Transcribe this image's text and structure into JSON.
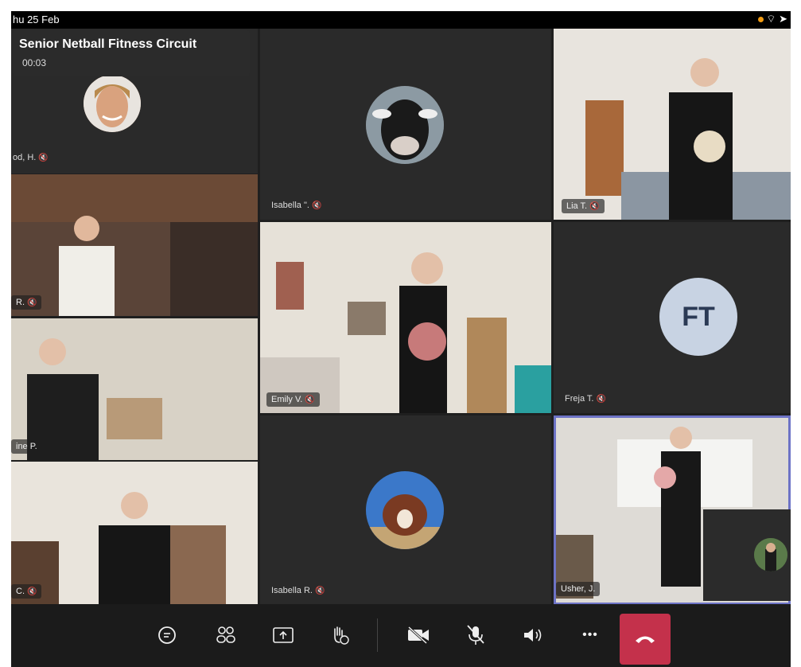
{
  "status_bar": {
    "time": "hu 25 Feb",
    "icons": "◉ ✈"
  },
  "meeting": {
    "title": "Senior Netball Fitness Circuit",
    "timer": "00:03"
  },
  "participants": {
    "host": "od, H.",
    "cow": "Isabella \".",
    "lia": "Lia T.",
    "r1": "R.",
    "emily": "Emily V.",
    "freja": "Freja T.",
    "freja_initials": "FT",
    "ine": "ine P.",
    "c": "C.",
    "isabella_r": "Isabella R.",
    "usher": "Usher, J."
  },
  "mic_icon": "🎙̸",
  "toolbar": {
    "chat": "chat-icon",
    "participants": "participants-icon",
    "share": "share-screen-icon",
    "raise_hand": "raise-hand-icon",
    "camera": "camera-off-icon",
    "mute": "mic-off-icon",
    "speaker": "speaker-icon",
    "more": "•••",
    "hangup": "hang-up-icon"
  },
  "colors": {
    "hangup": "#c4314b",
    "selected_outline": "#6d73c6",
    "initials_bg": "#c8d3e3"
  }
}
